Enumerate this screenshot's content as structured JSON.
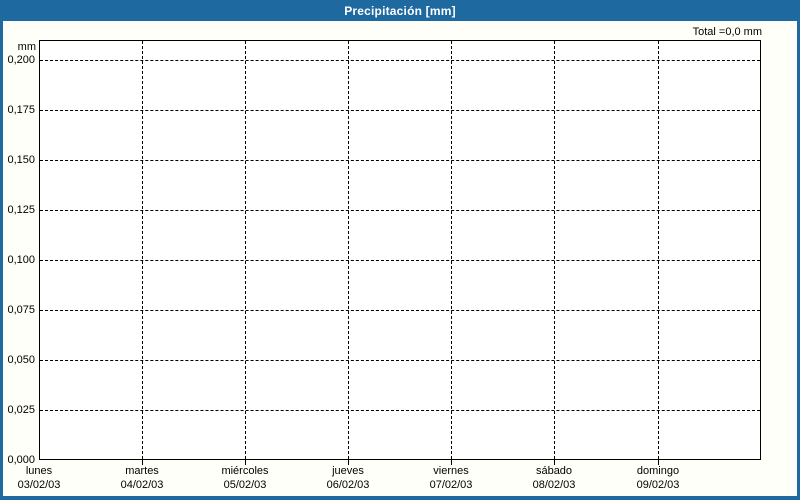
{
  "titlebar": {
    "title": "Precipitación [mm]"
  },
  "colors": {
    "titlebar_bg": "#1e69a0",
    "titlebar_text": "#ffffff",
    "frame": "#1e69a0",
    "plot_border": "#000000",
    "grid": "#000000",
    "background": "#fffffa",
    "plot_background": "#ffffff"
  },
  "chart_data": {
    "type": "bar",
    "title": "Precipitación [mm]",
    "ylabel": "mm",
    "xlabel": "",
    "total_annotation": "Total =0,0 mm",
    "total_mm": "0,0",
    "ylim": [
      0,
      0.21
    ],
    "y_ticks": [
      "0,200",
      "0,175",
      "0,150",
      "0,125",
      "0,100",
      "0,075",
      "0,050",
      "0,025",
      "0,000"
    ],
    "y_tick_values": [
      0.2,
      0.175,
      0.15,
      0.125,
      0.1,
      0.075,
      0.05,
      0.025,
      0.0
    ],
    "x_categories": [
      {
        "day": "lunes",
        "date": "03/02/03"
      },
      {
        "day": "martes",
        "date": "04/02/03"
      },
      {
        "day": "miércoles",
        "date": "05/02/03"
      },
      {
        "day": "jueves",
        "date": "06/02/03"
      },
      {
        "day": "viernes",
        "date": "07/02/03"
      },
      {
        "day": "sábado",
        "date": "08/02/03"
      },
      {
        "day": "domingo",
        "date": "09/02/03"
      }
    ],
    "series": [
      {
        "name": "Precipitación",
        "values": [
          0,
          0,
          0,
          0,
          0,
          0,
          0
        ]
      }
    ],
    "grid": {
      "horizontal": "dashed",
      "vertical": "dashed"
    },
    "legend": "none"
  }
}
